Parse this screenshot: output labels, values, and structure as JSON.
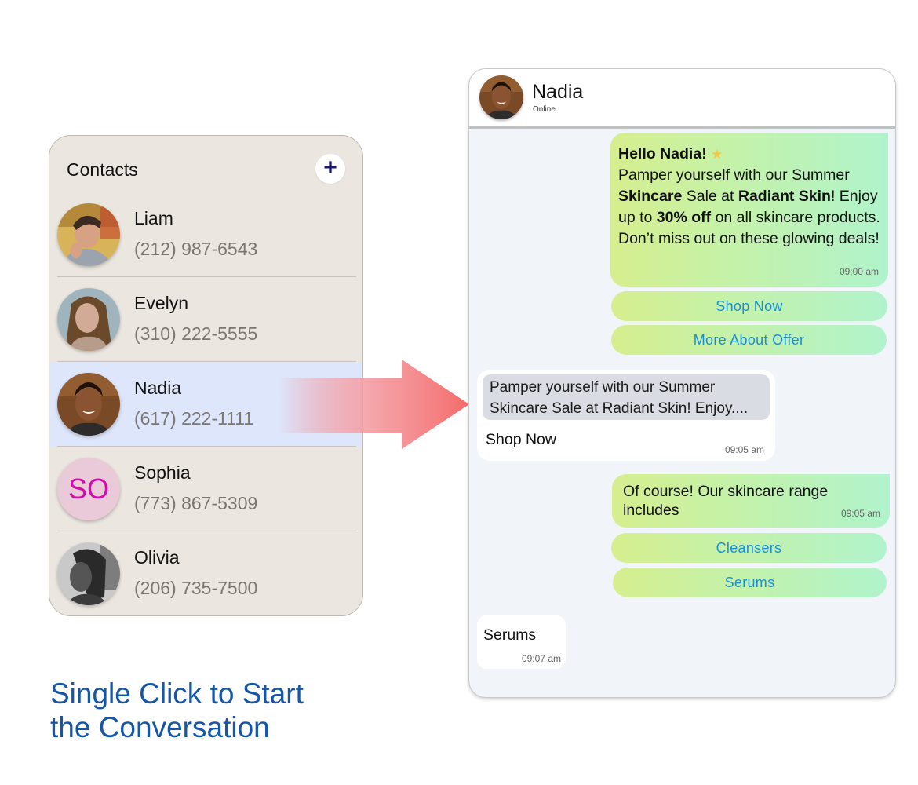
{
  "contacts": {
    "title": "Contacts",
    "add_button_label": "+",
    "items": [
      {
        "name": "Liam",
        "phone": "(212) 987-6543",
        "avatar": "photo",
        "selected": false
      },
      {
        "name": "Evelyn",
        "phone": "(310) 222-5555",
        "avatar": "photo",
        "selected": false
      },
      {
        "name": "Nadia",
        "phone": "(617) 222-1111",
        "avatar": "photo",
        "selected": true
      },
      {
        "name": "Sophia",
        "phone": "(773) 867-5309",
        "avatar": "initials",
        "initials": "SO",
        "selected": false
      },
      {
        "name": "Olivia",
        "phone": "(206) 735-7500",
        "avatar": "photo",
        "selected": false
      }
    ]
  },
  "tagline": {
    "line1": "Single Click to Start",
    "line2": "the Conversation"
  },
  "chat": {
    "header": {
      "name": "Nadia",
      "status": "Online"
    },
    "messages": [
      {
        "direction": "outgoing",
        "greeting": "Hello Nadia!",
        "emoji": "star-icon",
        "parts": {
          "p1": "Pamper yourself with our Summer ",
          "b1": "Skincare",
          "p2": " Sale at ",
          "b2": "Radiant Skin",
          "p3": "! Enjoy up to ",
          "b3": "30% off",
          "p4": " on all skincare products. Don’t miss out on these glowing deals!"
        },
        "time": "09:00 am",
        "quick_replies": [
          "Shop Now",
          "More About Offer"
        ]
      },
      {
        "direction": "incoming",
        "quoted": "Pamper yourself with our Summer Skincare Sale at Radiant Skin! Enjoy....",
        "text": "Shop Now",
        "time": "09:05 am"
      },
      {
        "direction": "outgoing",
        "text": "Of course! Our skincare range includes",
        "time": "09:05 am",
        "quick_replies": [
          "Cleansers",
          "Serums"
        ]
      },
      {
        "direction": "incoming",
        "text": "Serums",
        "time": "09:07 am"
      }
    ]
  },
  "colors": {
    "accent_blue": "#1656a6",
    "quick_reply_text": "#1a8fd6",
    "selected_row": "#dde6fb",
    "arrow": "#f46b6b",
    "initials_text": "#d10ea8"
  }
}
